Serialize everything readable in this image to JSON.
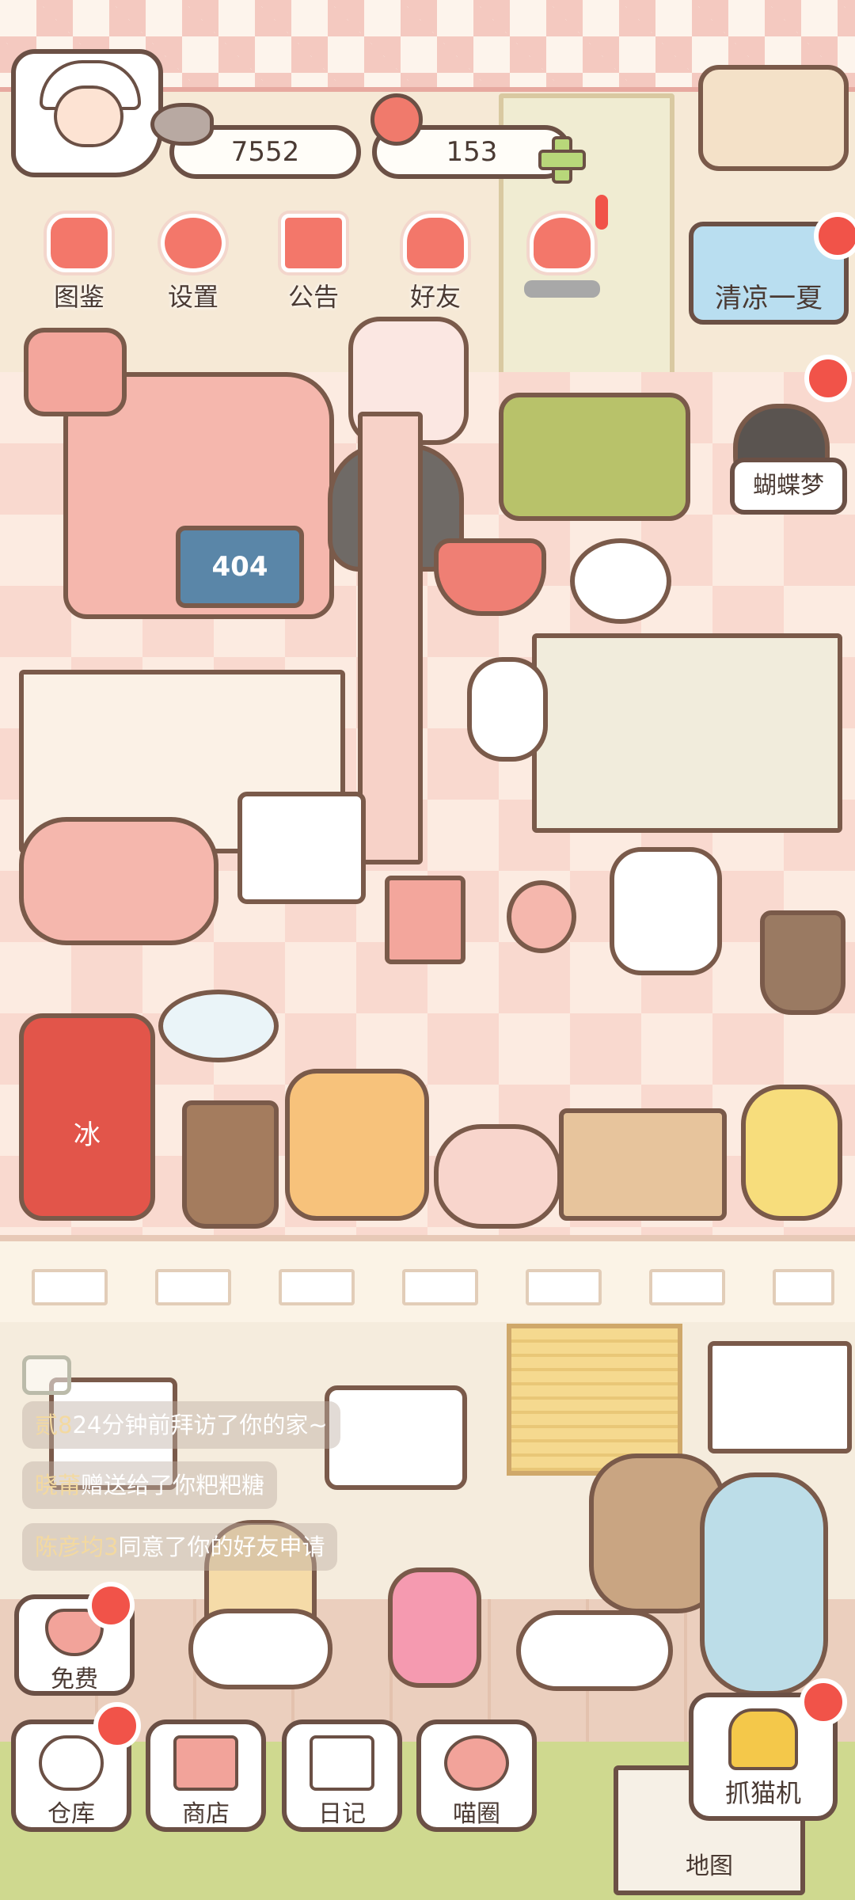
{
  "hud": {
    "coins": "7552",
    "tomatoes": "153"
  },
  "top_menu": [
    {
      "label": "图鉴",
      "icon": "cat-book-icon"
    },
    {
      "label": "设置",
      "icon": "gear-icon"
    },
    {
      "label": "公告",
      "icon": "gift-icon"
    },
    {
      "label": "好友",
      "icon": "friends-icon"
    }
  ],
  "events": {
    "summer": "清凉一夏",
    "butterfly": "蝴蝶梦"
  },
  "room": {
    "laptop_screen": "404",
    "ice_sign": "冰"
  },
  "chat": [
    {
      "who": "贰8",
      "text": "24分钟前拜访了你的家~"
    },
    {
      "who": "晓莆",
      "text": "赠送给了你粑粑糖"
    },
    {
      "who": "陈彦均3",
      "text": "同意了你的好友申请"
    }
  ],
  "bottom_menu": {
    "free": "免费",
    "storage": "仓库",
    "shop": "商店",
    "diary": "日记",
    "cat_circle": "喵圈",
    "claw": "抓猫机",
    "map": "地图"
  },
  "colors": {
    "badge": "#f15349",
    "outline": "#6b5045",
    "accent_pink": "#f3776a"
  }
}
